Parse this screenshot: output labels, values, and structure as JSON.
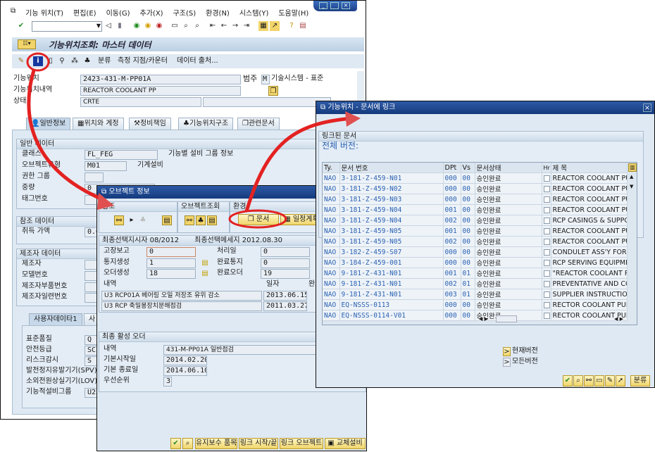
{
  "main": {
    "menu": [
      "기능 위치(T)",
      "편집(E)",
      "이동(G)",
      "추가(X)",
      "구조(S)",
      "환경(N)",
      "시스템(Y)",
      "도움말(H)"
    ],
    "title": "기능위치조회: 마스터 데이터",
    "app_toolbar": [
      "분류",
      "측정 지점/카운터",
      "데이터 출처..."
    ],
    "fields": {
      "fl_label": "기능위치",
      "fl_value": "2423-431-M-PP01A",
      "category_label": "범주",
      "category_value": "M",
      "category_text": "기술시스템 - 표준",
      "desc_label": "기능위치내역",
      "desc_value": "REACTOR COOLANT PP",
      "status_label": "상태",
      "status_value": "CRTE"
    },
    "tabs": [
      "일반정보",
      "위치와 계정",
      "정비책임",
      "기능위치구조",
      "관련문서"
    ],
    "general": {
      "header": "일반 데이터",
      "rows": [
        {
          "label": "클래스",
          "value": "FL_FEG",
          "text": "기능별 설비 그룹 정보"
        },
        {
          "label": "오브젝트유형",
          "value": "M01",
          "text": "기계설비"
        },
        {
          "label": "권한 그룹",
          "value": ""
        },
        {
          "label": "중량",
          "value": "0"
        },
        {
          "label": "태그번호",
          "value": ""
        }
      ]
    },
    "ref": {
      "header": "참조 데이터",
      "label": "취득 가액",
      "value": "0.0"
    },
    "mfr": {
      "header": "제조자 데이터",
      "labels": [
        "제조자",
        "모델번호",
        "제조자부품번호",
        "제조자일련번호"
      ]
    },
    "user_tabs": [
      "사용자데이타1",
      "사"
    ],
    "user": [
      {
        "label": "표준품질",
        "value": "Q"
      },
      {
        "label": "안전등급",
        "value": "SC1"
      },
      {
        "label": "리스크감시",
        "value": "S"
      },
      {
        "label": "발전정지유발기기(SPV)",
        "value": ""
      },
      {
        "label": "소외전원상실기기(LOV)",
        "value": ""
      },
      {
        "label": "기능적설비그룹",
        "value": "U23"
      }
    ]
  },
  "objinfo": {
    "title": "오브젝트 정보",
    "sections": [
      "참조",
      "오브젝트조회",
      "환경"
    ],
    "doc_button": "문서",
    "schedule_button": "일정계획",
    "stats_header_a": "최종선택지시자 08/2012",
    "stats_header_b": "최종선택메세지 2012.08.30",
    "stats": [
      {
        "label": "고장보고",
        "value": "0",
        "label2": "처리일",
        "value2": "0"
      },
      {
        "label": "통지생성",
        "value": "1",
        "label2": "완료통지",
        "value2": "0"
      },
      {
        "label": "오더생성",
        "value": "18",
        "label2": "완료오더",
        "value2": "19"
      }
    ],
    "hist_cols": [
      "내역",
      "일자",
      "완료"
    ],
    "history": [
      {
        "text": "U3 RCP01A 베어링 오일 저장조 유위 감소",
        "date": "2013.06.15"
      },
      {
        "text": "U3 RCP 축밀봉장치분해점검",
        "date": "2011.03.27"
      }
    ],
    "last_order_header": "최종 활성 오더",
    "last_order": [
      {
        "label": "내역",
        "value": "431-M-PP01A 일반점검"
      },
      {
        "label": "기본시작일",
        "value": "2014.02.20"
      },
      {
        "label": "기본 종료일",
        "value": "2014.06.10"
      },
      {
        "label": "우선순위",
        "value": "3"
      }
    ],
    "buttons": [
      "유지보수 품목",
      "링크 시작/끝",
      "링크 오브젝트",
      "교체설비"
    ]
  },
  "docs": {
    "title": "기능위치 - 문서에 링크",
    "group": "링크된 문서",
    "all_versions": "전체 버전:",
    "columns": [
      "Ty.",
      "문서 번호",
      "DPt",
      "Vs",
      "문서상태",
      "Hr",
      "제 목"
    ],
    "rows": [
      [
        "NAO",
        "3-181-Z-459-N01",
        "000",
        "00",
        "승인완료",
        "REACTOR COOLANT PUMP C"
      ],
      [
        "NAO",
        "3-181-Z-459-N02",
        "000",
        "00",
        "승인완료",
        "REACTOR COOLANT PUMP C"
      ],
      [
        "NAO",
        "3-181-Z-459-N03",
        "000",
        "00",
        "승인완료",
        "REACTOR COOLANT PUMP C"
      ],
      [
        "NAO",
        "3-181-Z-459-N04",
        "001",
        "00",
        "승인완료",
        "REACTOR COOLANT PUMP C"
      ],
      [
        "NAO",
        "3-181-Z-459-N04",
        "002",
        "00",
        "승인완료",
        "RCP CASINGS & SUPPORT SI"
      ],
      [
        "NAO",
        "3-181-Z-459-N05",
        "001",
        "00",
        "승인완료",
        "REACTOR COOLANT PUMP II"
      ],
      [
        "NAO",
        "3-181-Z-459-N05",
        "002",
        "00",
        "승인완료",
        "REACTOR COOLANT PUMP II"
      ],
      [
        "NAO",
        "3-182-Z-459-S07",
        "000",
        "00",
        "승인완료",
        "CONDULET ASS'Y FOR RCP M"
      ],
      [
        "NAO",
        "3-184-Z-459-001",
        "000",
        "00",
        "승인완료",
        "RCP SERVING EQUIPMENT"
      ],
      [
        "NAO",
        "9-181-Z-431-N01",
        "001",
        "01",
        "승인완료",
        "\"REACTOR COOLANT PUMP"
      ],
      [
        "NAO",
        "9-181-Z-431-N01",
        "002",
        "01",
        "승인완료",
        "PREVENTATIVE AND CORRE"
      ],
      [
        "NAO",
        "9-181-Z-431-N01",
        "003",
        "01",
        "승인완료",
        "SUPPLIER INSTRUCTIONS FC"
      ],
      [
        "NAO",
        "EQ-NSSS-0113",
        "000",
        "00",
        "승인완료",
        "RECTOR COOLANT PUMP"
      ],
      [
        "NAO",
        "EQ-NSSS-0114-V01",
        "000",
        "00",
        "승인완료",
        "RECTOR COOLANT PUMP"
      ]
    ],
    "current_version": "현재버전",
    "all_version_btn": "모든버전",
    "classify_button": "분류"
  },
  "colors": {
    "highlight": "#e32222",
    "title_bar": "#1f4b92",
    "doc_link": "#2a62b2"
  }
}
